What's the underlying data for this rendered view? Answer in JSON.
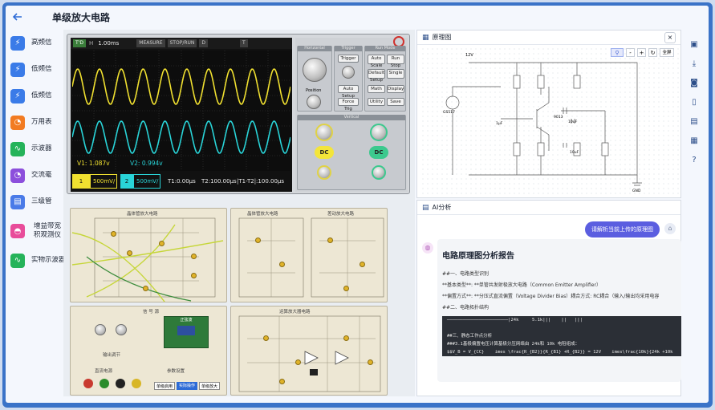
{
  "app": {
    "title": "单级放大电路",
    "back_icon": "arrow-left-icon"
  },
  "sidebar": {
    "items": [
      {
        "label": "高频信",
        "color": "#3a7be8",
        "icon": "lightning-icon"
      },
      {
        "label": "低频信",
        "color": "#3a7be8",
        "icon": "lightning-icon"
      },
      {
        "label": "低频信",
        "color": "#3a7be8",
        "icon": "lightning-icon"
      },
      {
        "label": "万用表",
        "color": "#f27b22",
        "icon": "meter-icon"
      },
      {
        "label": "示波器",
        "color": "#25b35a",
        "icon": "wave-icon"
      },
      {
        "label": "交流毫",
        "color": "#8c4fdc",
        "icon": "meter-icon"
      },
      {
        "label": "三级管",
        "color": "#4a7be8",
        "icon": "transistor-icon"
      },
      {
        "label": "增益带宽积观测仪",
        "color": "#e84c9a",
        "icon": "gauge-icon"
      },
      {
        "label": "实物示波器",
        "color": "#25b35a",
        "icon": "wave-icon"
      }
    ]
  },
  "scope": {
    "trigger_label": "T'D",
    "h_label": "H",
    "timebase": "1.00ms",
    "measure_label": "MEASURE",
    "state_label": "STOP/RUN",
    "d_label": "D",
    "t_label": "T",
    "v1": "V1: 1.087v",
    "v2": "V2: 0.994v",
    "ch1_num": "1",
    "ch1_scale": "500mV/",
    "ch2_num": "2",
    "ch2_scale": "500mV/",
    "t1": "T1:0.00μs",
    "t2": "T2:100.00μs",
    "dt": "|T1-T2|:100.00μs",
    "ch1_color": "#f0e030",
    "ch2_color": "#29d4d8"
  },
  "scope_panel": {
    "horizontal": "Horizontal",
    "trigger": "Trigger",
    "run_mode": "Run Mode",
    "position": "Position",
    "btn_trigger": "Trigger",
    "btn_auto": "Auto Scale",
    "btn_run": "Run Stop",
    "btn_default": "Default Setup",
    "btn_single": "Single",
    "btn_auto2": "Auto Setup",
    "btn_math": "Math",
    "btn_display": "Display",
    "btn_force": "Force Trig",
    "btn_utility": "Utility",
    "btn_save": "Save",
    "vertical": "Vertical",
    "dc1": "DC",
    "dc2": "DC"
  },
  "boards": {
    "b1_title": "晶体管放大电路",
    "b2_title": "晶体管放大电路",
    "b3_title": "差动放大电路",
    "b4_title": "信 号 源",
    "b5_title": "运算放大器电路",
    "b4_label1": "正弦波",
    "b4_label2": "输出调节",
    "b4_label3": "直流电源",
    "b4_label4": "电源调节",
    "b4_label5": "参数设置",
    "b4_btn1": "单级启用",
    "b4_btn2": "实际操作",
    "b4_btn3": "单级放大"
  },
  "schematic": {
    "title": "原理图",
    "close_icon": "close-icon",
    "zoom_out": "-",
    "zoom_in": "+",
    "fit": "全屏",
    "vcc": "12V",
    "source": "GS517",
    "cap1": "1μF",
    "cap2": "10uF",
    "cap3": "10uF",
    "q1": "9013",
    "gnd": "GND"
  },
  "ai": {
    "title": "AI分析",
    "user_msg": "请解析当前上传的原理图",
    "report_title": "电路原理图分析报告",
    "line1": "##一、电路类型识别",
    "line2": "**基本类型**: **单管共发射极放大电路（Common Emitter Amplifier）",
    "line3": "**偏置方式**: **分压式直流偏置（Voltage Divider Bias）耦合方式: RC耦合（输入/输出均采用电容",
    "line4": "##二、电路拓扑结构",
    "code": "───────────────────────|24k     5.1k|||    ||   |||   \n\n##三、静态工作点分析\n###3.1基极偏置电压计算基极分压网络由 24k和 10k 电阻组成：\n$$V_B = V_{CC}    imes \\frac{R_{B2}}{R_{B1} +R_{B2}} = 12V    imes\\frac{10k}{24k +10k"
  },
  "right_rail": [
    "save-icon",
    "download-icon",
    "camera-icon",
    "book-icon",
    "document-icon",
    "notes-icon",
    "help-icon"
  ]
}
